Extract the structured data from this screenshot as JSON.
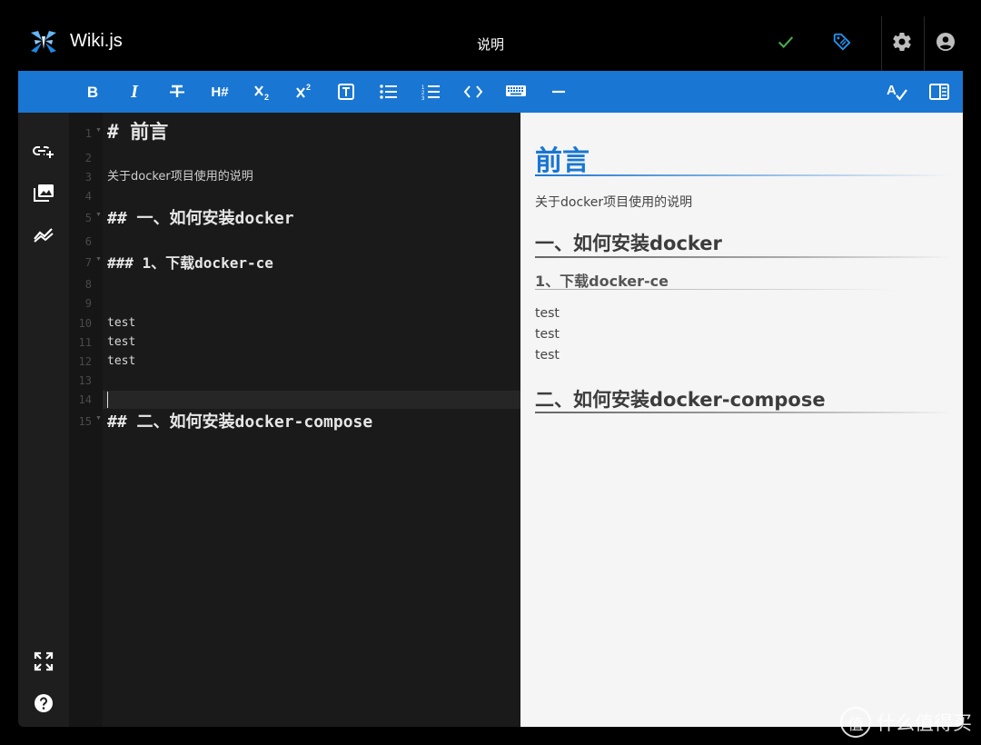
{
  "header": {
    "app_title": "Wiki.js",
    "page_title": "说明"
  },
  "colors": {
    "accent": "#1976d2",
    "save_check": "#4caf50",
    "tag_icon": "#2196f3"
  },
  "toolbar": {
    "buttons": [
      {
        "name": "bold-button",
        "label": "B",
        "icon": "bold-icon"
      },
      {
        "name": "italic-button",
        "label": "I",
        "icon": "italic-icon"
      },
      {
        "name": "strikethrough-button",
        "label": "",
        "icon": "strikethrough-icon"
      },
      {
        "name": "heading-button",
        "label": "H#",
        "icon": "heading-icon"
      },
      {
        "name": "subscript-button",
        "label": "",
        "icon": "subscript-icon"
      },
      {
        "name": "superscript-button",
        "label": "",
        "icon": "superscript-icon"
      },
      {
        "name": "blockquote-button",
        "label": "",
        "icon": "text-box-icon"
      },
      {
        "name": "unordered-list-button",
        "label": "",
        "icon": "list-bulleted-icon"
      },
      {
        "name": "ordered-list-button",
        "label": "",
        "icon": "list-numbered-icon"
      },
      {
        "name": "inline-code-button",
        "label": "",
        "icon": "code-icon"
      },
      {
        "name": "keyboard-key-button",
        "label": "",
        "icon": "keyboard-icon"
      },
      {
        "name": "horizontal-rule-button",
        "label": "",
        "icon": "minus-icon"
      }
    ]
  },
  "editor": {
    "lines": [
      {
        "n": "1",
        "text": "# 前言",
        "style": "h1",
        "fold": true
      },
      {
        "n": "2",
        "text": "",
        "style": "body",
        "fold": false
      },
      {
        "n": "3",
        "text": "关于docker项目使用的说明",
        "style": "body",
        "fold": false
      },
      {
        "n": "4",
        "text": "",
        "style": "body",
        "fold": false
      },
      {
        "n": "5",
        "text": "## 一、如何安装docker",
        "style": "h2",
        "fold": true
      },
      {
        "n": "6",
        "text": "",
        "style": "body",
        "fold": false
      },
      {
        "n": "7",
        "text": "### 1、下载docker-ce",
        "style": "h3",
        "fold": true
      },
      {
        "n": "8",
        "text": "",
        "style": "body",
        "fold": false
      },
      {
        "n": "9",
        "text": "",
        "style": "body",
        "fold": false
      },
      {
        "n": "10",
        "text": "test",
        "style": "mono",
        "fold": false
      },
      {
        "n": "11",
        "text": "test",
        "style": "mono",
        "fold": false
      },
      {
        "n": "12",
        "text": "test",
        "style": "mono",
        "fold": false
      },
      {
        "n": "13",
        "text": "",
        "style": "body",
        "fold": false
      },
      {
        "n": "14",
        "text": "",
        "style": "body",
        "fold": false
      },
      {
        "n": "15",
        "text": "## 二、如何安装docker-compose",
        "style": "h2",
        "fold": true
      }
    ]
  },
  "preview": {
    "h1": "前言",
    "intro": "关于docker项目使用的说明",
    "h2_a": "一、如何安装docker",
    "h3_a": "1、下载docker-ce",
    "body_lines": [
      "test",
      "test",
      "test"
    ],
    "h2_b": "二、如何安装docker-compose"
  },
  "watermark": {
    "circle_glyph": "值",
    "text": "什么值得买"
  }
}
